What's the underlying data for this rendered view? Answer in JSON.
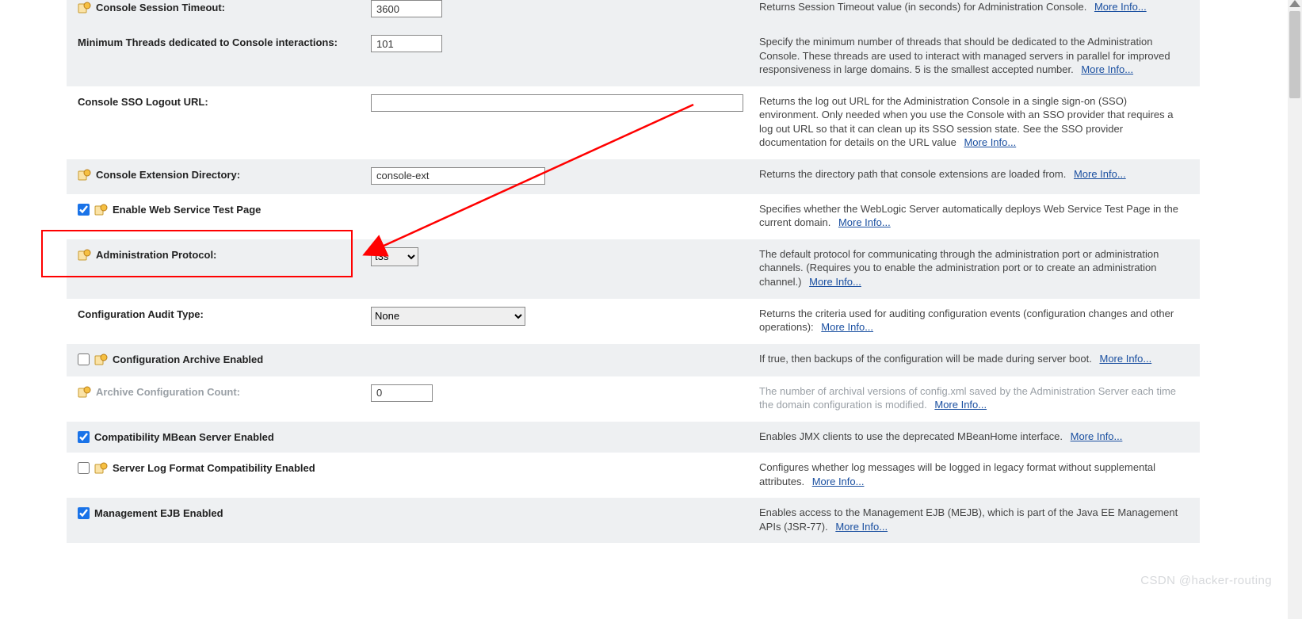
{
  "link_more": "More Info...",
  "icons": {
    "restart": "restart-required-icon"
  },
  "watermark": "CSDN @hacker-routing",
  "rows": {
    "session_timeout": {
      "label": "Console Session Timeout:",
      "value": "3600",
      "desc": "Returns Session Timeout value (in seconds) for Administration Console."
    },
    "min_threads": {
      "label": "Minimum Threads dedicated to Console interactions:",
      "value": "101",
      "desc": "Specify the minimum number of threads that should be dedicated to the Administration Console. These threads are used to interact with managed servers in parallel for improved responsiveness in large domains. 5 is the smallest accepted number."
    },
    "sso_logout": {
      "label": "Console SSO Logout URL:",
      "value": "",
      "desc": "Returns the log out URL for the Administration Console in a single sign-on (SSO) environment. Only needed when you use the Console with an SSO provider that requires a log out URL so that it can clean up its SSO session state. See the SSO provider documentation for details on the URL value"
    },
    "ext_dir": {
      "label": "Console Extension Directory:",
      "value": "console-ext",
      "desc": "Returns the directory path that console extensions are loaded from."
    },
    "web_test": {
      "label": "Enable Web Service Test Page",
      "checked": true,
      "desc": "Specifies whether the WebLogic Server automatically deploys Web Service Test Page in the current domain."
    },
    "admin_proto": {
      "label": "Administration Protocol:",
      "value": "t3s",
      "desc": "The default protocol for communicating through the administration port or administration channels. (Requires you to enable the administration port or to create an administration channel.)"
    },
    "audit_type": {
      "label": "Configuration Audit Type:",
      "value": "None",
      "desc": "Returns the criteria used for auditing configuration events (configuration changes and other operations):"
    },
    "archive_enabled": {
      "label": "Configuration Archive Enabled",
      "checked": false,
      "desc": "If true, then backups of the configuration will be made during server boot."
    },
    "archive_count": {
      "label": "Archive Configuration Count:",
      "value": "0",
      "desc": "The number of archival versions of config.xml saved by the Administration Server each time the domain configuration is modified."
    },
    "compat_mbean": {
      "label": "Compatibility MBean Server Enabled",
      "checked": true,
      "desc": "Enables JMX clients to use the deprecated MBeanHome interface."
    },
    "log_compat": {
      "label": "Server Log Format Compatibility Enabled",
      "checked": false,
      "desc": "Configures whether log messages will be logged in legacy format without supplemental attributes."
    },
    "mgmt_ejb": {
      "label": "Management EJB Enabled",
      "checked": true,
      "desc": "Enables access to the Management EJB (MEJB), which is part of the Java EE Management APIs (JSR-77)."
    }
  }
}
